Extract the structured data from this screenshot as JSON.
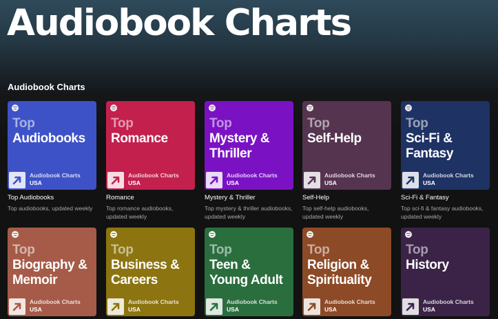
{
  "header": {
    "title": "Audiobook Charts"
  },
  "section": {
    "title": "Audiobook Charts"
  },
  "cover_common": {
    "top_word": "Top",
    "brand": "Audiobook Charts",
    "region": "USA"
  },
  "cards": [
    {
      "name": "Audiobooks",
      "title": "Top Audiobooks",
      "desc": "Top audiobooks, updated weekly",
      "color": "#3e52c7",
      "accent": "#3e52c7"
    },
    {
      "name": "Romance",
      "title": "Romance",
      "desc": "Top romance audiobooks, updated weekly",
      "color": "#c3204e",
      "accent": "#c3204e"
    },
    {
      "name": "Mystery &\nThriller",
      "title": "Mystery & Thriller",
      "desc": "Top mystery & thriller audiobooks, updated weekly",
      "color": "#7a12c4",
      "accent": "#7a12c4"
    },
    {
      "name": "Self-Help",
      "title": "Self-Help",
      "desc": "Top self-help audiobooks, updated weekly",
      "color": "#553450",
      "accent": "#553450"
    },
    {
      "name": "Sci-Fi &\nFantasy",
      "title": "Sci-Fi & Fantasy",
      "desc": "Top sci-fi & fantasy audiobooks, updated weekly",
      "color": "#1e3264",
      "accent": "#1e3264"
    },
    {
      "name": "Biography &\nMemoir",
      "title": "",
      "desc": "",
      "color": "#a55b48",
      "accent": "#a55b48"
    },
    {
      "name": "Business &\nCareers",
      "title": "",
      "desc": "",
      "color": "#8c7410",
      "accent": "#8c7410"
    },
    {
      "name": "Teen &\nYoung Adult",
      "title": "",
      "desc": "",
      "color": "#2b6e3e",
      "accent": "#2b6e3e"
    },
    {
      "name": "Religion &\nSpirituality",
      "title": "",
      "desc": "",
      "color": "#8d4a26",
      "accent": "#8d4a26"
    },
    {
      "name": "History",
      "title": "",
      "desc": "",
      "color": "#3b2347",
      "accent": "#3b2347"
    }
  ]
}
